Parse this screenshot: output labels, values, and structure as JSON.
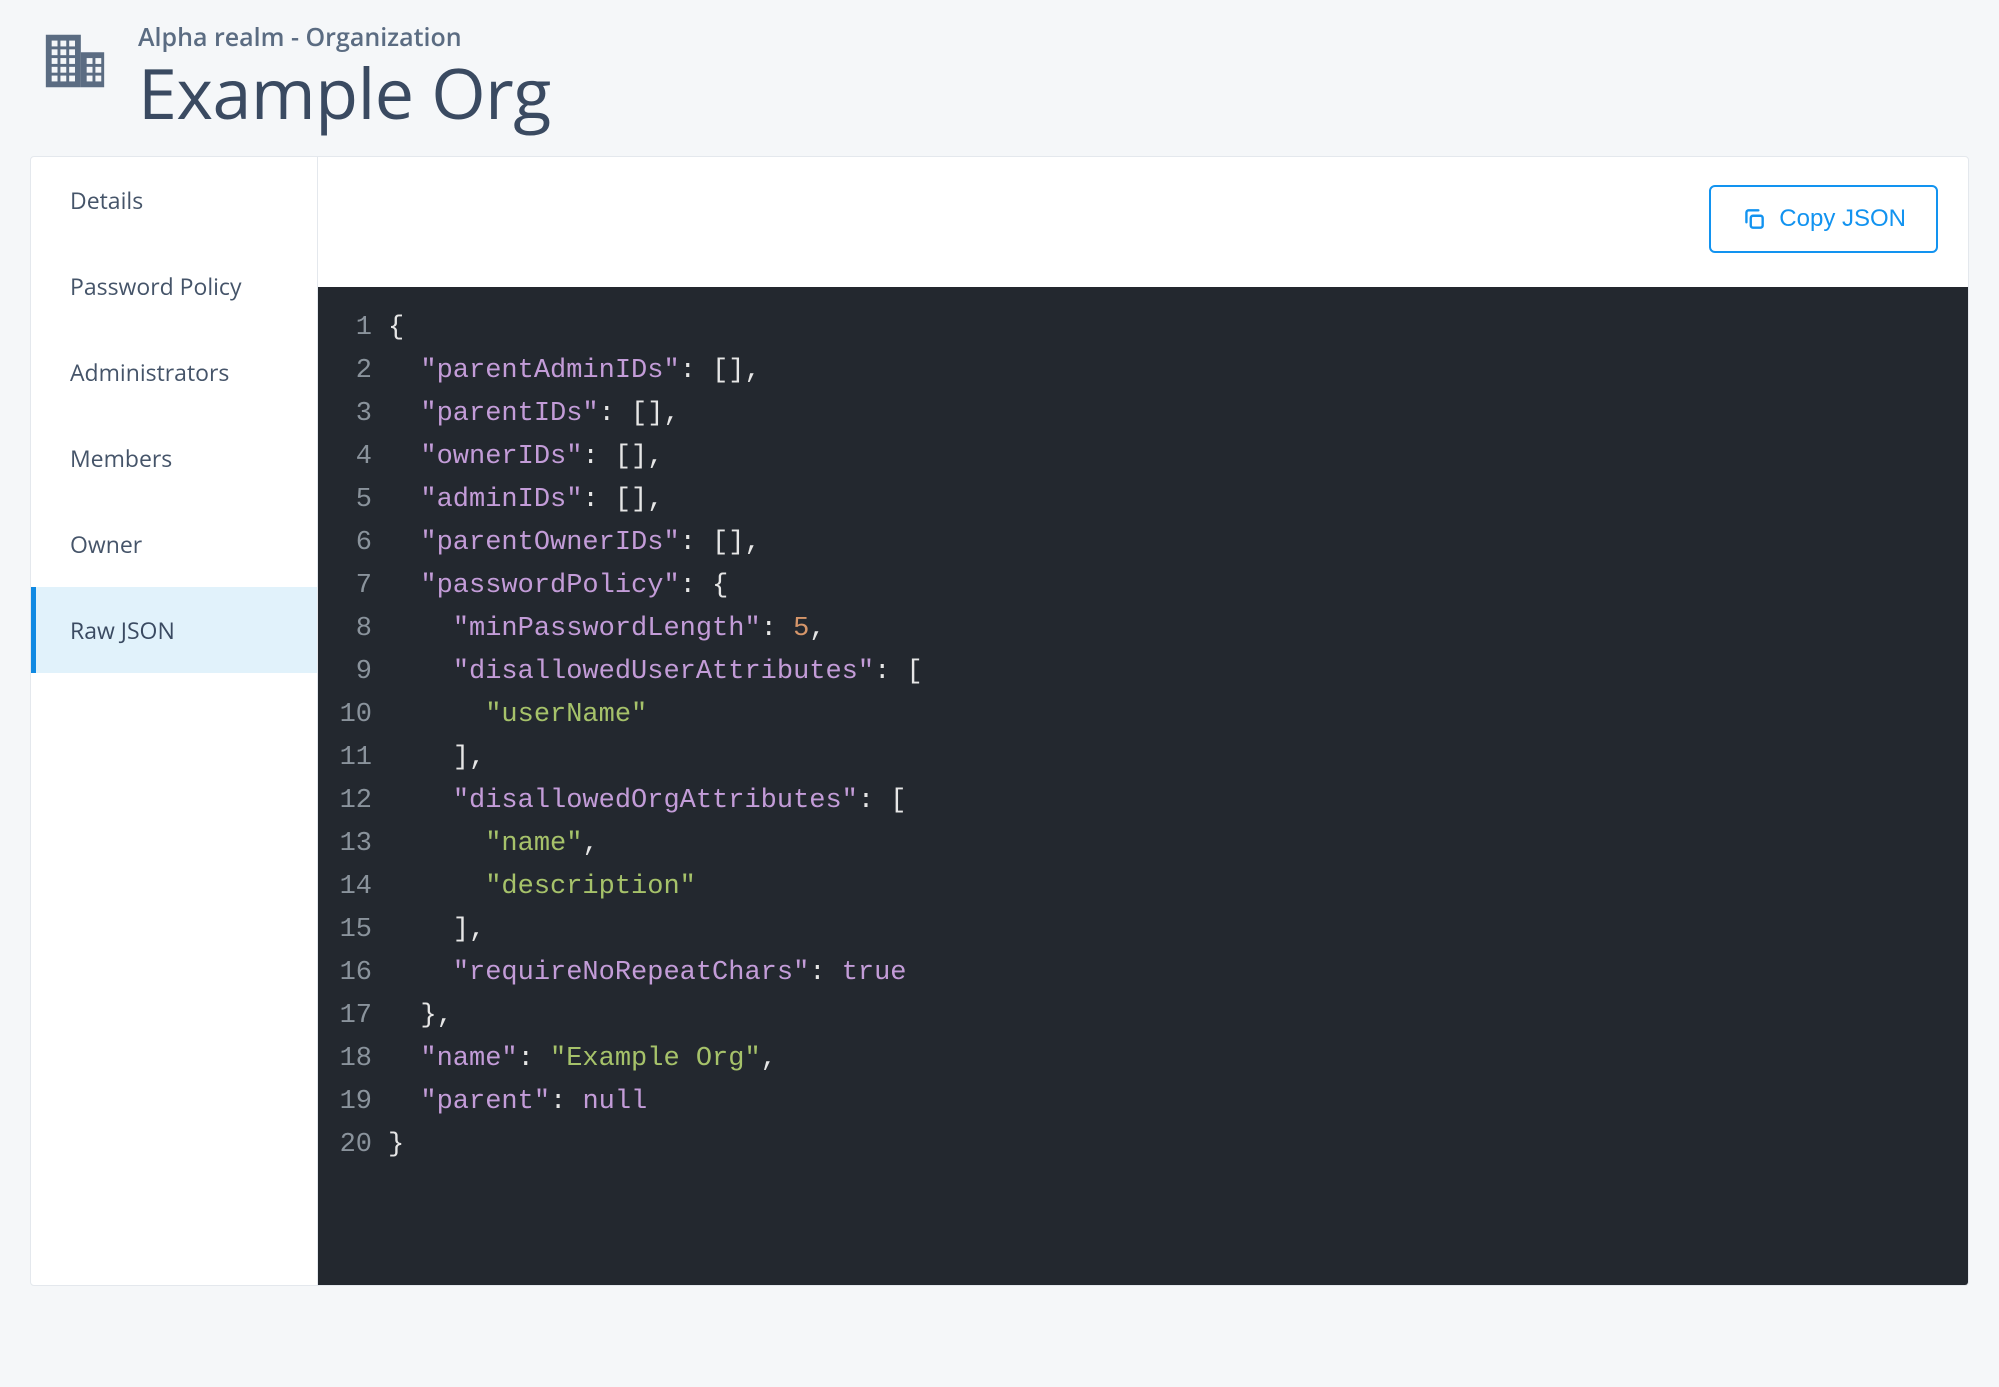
{
  "header": {
    "breadcrumb": "Alpha realm - Organization",
    "title": "Example Org"
  },
  "sidebar": {
    "items": [
      {
        "label": "Details",
        "active": false
      },
      {
        "label": "Password Policy",
        "active": false
      },
      {
        "label": "Administrators",
        "active": false
      },
      {
        "label": "Members",
        "active": false
      },
      {
        "label": "Owner",
        "active": false
      },
      {
        "label": "Raw JSON",
        "active": true
      }
    ]
  },
  "toolbar": {
    "copy_label": "Copy JSON"
  },
  "code": {
    "lines": [
      {
        "n": "1",
        "indent": 0,
        "tokens": [
          {
            "t": "{",
            "c": "brace"
          }
        ]
      },
      {
        "n": "2",
        "indent": 1,
        "tokens": [
          {
            "t": "\"parentAdminIDs\"",
            "c": "key"
          },
          {
            "t": ": ",
            "c": "punct"
          },
          {
            "t": "[]",
            "c": "punct"
          },
          {
            "t": ",",
            "c": "punct"
          }
        ]
      },
      {
        "n": "3",
        "indent": 1,
        "tokens": [
          {
            "t": "\"parentIDs\"",
            "c": "key"
          },
          {
            "t": ": ",
            "c": "punct"
          },
          {
            "t": "[]",
            "c": "punct"
          },
          {
            "t": ",",
            "c": "punct"
          }
        ]
      },
      {
        "n": "4",
        "indent": 1,
        "tokens": [
          {
            "t": "\"ownerIDs\"",
            "c": "key"
          },
          {
            "t": ": ",
            "c": "punct"
          },
          {
            "t": "[]",
            "c": "punct"
          },
          {
            "t": ",",
            "c": "punct"
          }
        ]
      },
      {
        "n": "5",
        "indent": 1,
        "tokens": [
          {
            "t": "\"adminIDs\"",
            "c": "key"
          },
          {
            "t": ": ",
            "c": "punct"
          },
          {
            "t": "[]",
            "c": "punct"
          },
          {
            "t": ",",
            "c": "punct"
          }
        ]
      },
      {
        "n": "6",
        "indent": 1,
        "tokens": [
          {
            "t": "\"parentOwnerIDs\"",
            "c": "key"
          },
          {
            "t": ": ",
            "c": "punct"
          },
          {
            "t": "[]",
            "c": "punct"
          },
          {
            "t": ",",
            "c": "punct"
          }
        ]
      },
      {
        "n": "7",
        "indent": 1,
        "tokens": [
          {
            "t": "\"passwordPolicy\"",
            "c": "key"
          },
          {
            "t": ": ",
            "c": "punct"
          },
          {
            "t": "{",
            "c": "brace"
          }
        ]
      },
      {
        "n": "8",
        "indent": 2,
        "tokens": [
          {
            "t": "\"minPasswordLength\"",
            "c": "key"
          },
          {
            "t": ": ",
            "c": "punct"
          },
          {
            "t": "5",
            "c": "num"
          },
          {
            "t": ",",
            "c": "punct"
          }
        ]
      },
      {
        "n": "9",
        "indent": 2,
        "tokens": [
          {
            "t": "\"disallowedUserAttributes\"",
            "c": "key"
          },
          {
            "t": ": ",
            "c": "punct"
          },
          {
            "t": "[",
            "c": "punct"
          }
        ]
      },
      {
        "n": "10",
        "indent": 3,
        "tokens": [
          {
            "t": "\"userName\"",
            "c": "str"
          }
        ]
      },
      {
        "n": "11",
        "indent": 2,
        "tokens": [
          {
            "t": "]",
            "c": "punct"
          },
          {
            "t": ",",
            "c": "punct"
          }
        ]
      },
      {
        "n": "12",
        "indent": 2,
        "tokens": [
          {
            "t": "\"disallowedOrgAttributes\"",
            "c": "key"
          },
          {
            "t": ": ",
            "c": "punct"
          },
          {
            "t": "[",
            "c": "punct"
          }
        ]
      },
      {
        "n": "13",
        "indent": 3,
        "tokens": [
          {
            "t": "\"name\"",
            "c": "str"
          },
          {
            "t": ",",
            "c": "punct"
          }
        ]
      },
      {
        "n": "14",
        "indent": 3,
        "tokens": [
          {
            "t": "\"description\"",
            "c": "str"
          }
        ]
      },
      {
        "n": "15",
        "indent": 2,
        "tokens": [
          {
            "t": "]",
            "c": "punct"
          },
          {
            "t": ",",
            "c": "punct"
          }
        ]
      },
      {
        "n": "16",
        "indent": 2,
        "tokens": [
          {
            "t": "\"requireNoRepeatChars\"",
            "c": "key"
          },
          {
            "t": ": ",
            "c": "punct"
          },
          {
            "t": "true",
            "c": "bool"
          }
        ]
      },
      {
        "n": "17",
        "indent": 1,
        "tokens": [
          {
            "t": "}",
            "c": "brace"
          },
          {
            "t": ",",
            "c": "punct"
          }
        ]
      },
      {
        "n": "18",
        "indent": 1,
        "tokens": [
          {
            "t": "\"name\"",
            "c": "key"
          },
          {
            "t": ": ",
            "c": "punct"
          },
          {
            "t": "\"Example Org\"",
            "c": "str"
          },
          {
            "t": ",",
            "c": "punct"
          }
        ]
      },
      {
        "n": "19",
        "indent": 1,
        "tokens": [
          {
            "t": "\"parent\"",
            "c": "key"
          },
          {
            "t": ": ",
            "c": "punct"
          },
          {
            "t": "null",
            "c": "null"
          }
        ]
      },
      {
        "n": "20",
        "indent": 0,
        "tokens": [
          {
            "t": "}",
            "c": "brace"
          }
        ]
      }
    ]
  }
}
